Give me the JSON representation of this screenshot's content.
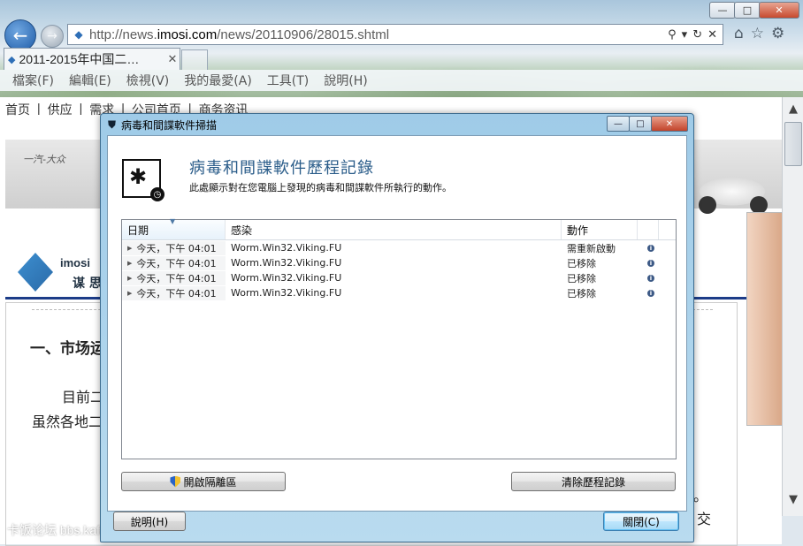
{
  "browser": {
    "url_prefix": "http://news.",
    "url_domain": "imosi.com",
    "url_path": "/news/20110906/28015.shtml",
    "tab_title": "2011-2015年中国二…",
    "menu": [
      "檔案(F)",
      "編輯(E)",
      "檢視(V)",
      "我的最愛(A)",
      "工具(T)",
      "說明(H)"
    ],
    "window_buttons": {
      "minimize": "—",
      "maximize": "□",
      "close": "✕"
    }
  },
  "page": {
    "nav": [
      "首页",
      "|",
      "供应",
      "|",
      "需求",
      "|",
      "公司首页",
      "|",
      "商务资讯"
    ],
    "banner_brand": "一汽-大众",
    "logo_text": "imosi",
    "logo_sub": "谋 思",
    "heading": "一、市场运",
    "para1": "目前二",
    "para2": "虽然各地二",
    "right_text": "交",
    "right_char": "。",
    "watermark": "卡饭论坛 bbs.kafan.cn"
  },
  "dialog": {
    "title": "病毒和間諜軟件掃描",
    "header_title": "病毒和間諜軟件歷程記錄",
    "header_desc": "此處顯示對在您電腦上發現的病毒和間諜軟件所執行的動作。",
    "columns": [
      "日期",
      "感染",
      "動作"
    ],
    "rows": [
      {
        "date": "今天，下午 04:01",
        "infection": "Worm.Win32.Viking.FU",
        "action": "需重新啟動"
      },
      {
        "date": "今天，下午 04:01",
        "infection": "Worm.Win32.Viking.FU",
        "action": "已移除"
      },
      {
        "date": "今天，下午 04:01",
        "infection": "Worm.Win32.Viking.FU",
        "action": "已移除"
      },
      {
        "date": "今天，下午 04:01",
        "infection": "Worm.Win32.Viking.FU",
        "action": "已移除"
      }
    ],
    "btn_quarantine": "開啟隔離區",
    "btn_clear": "清除歷程記錄",
    "btn_help": "說明(H)",
    "btn_close": "關閉(C)"
  }
}
